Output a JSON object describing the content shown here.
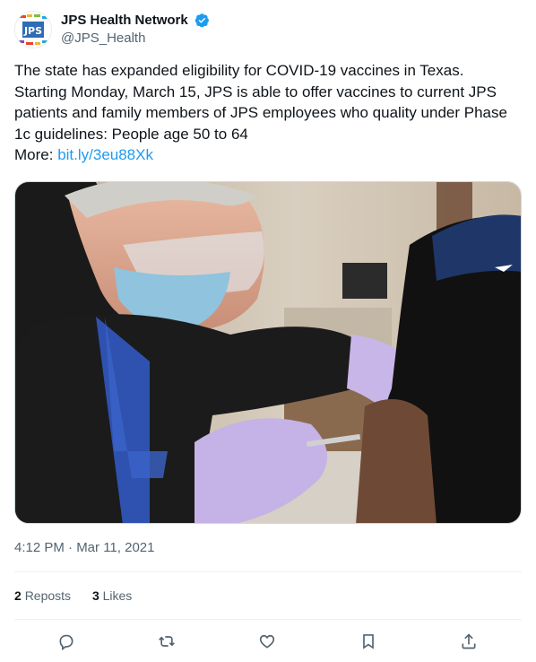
{
  "account": {
    "display_name": "JPS Health Network",
    "handle": "@JPS_Health",
    "logo_text": "JPS"
  },
  "tweet": {
    "lines": [
      "The state has expanded eligibility for COVID-19 vaccines in Texas.",
      "Starting Monday, March 15, JPS is able to offer vaccines to current JPS",
      "patients and family members of JPS employees who quality under Phase",
      "1c guidelines: People age 50 to 64"
    ],
    "more_label": "More: ",
    "link": "bit.ly/3eu88Xk",
    "timestamp": "4:12 PM · Mar 11, 2021"
  },
  "stats": {
    "reposts_count": "2",
    "reposts_label": "Reposts",
    "likes_count": "3",
    "likes_label": "Likes"
  },
  "colors": {
    "link": "#1d9bf0",
    "verified": "#1d9bf0",
    "secondary_text": "#536471"
  },
  "icons": [
    "reply-icon",
    "repost-icon",
    "like-icon",
    "bookmark-icon",
    "share-icon",
    "verified-badge-icon"
  ]
}
